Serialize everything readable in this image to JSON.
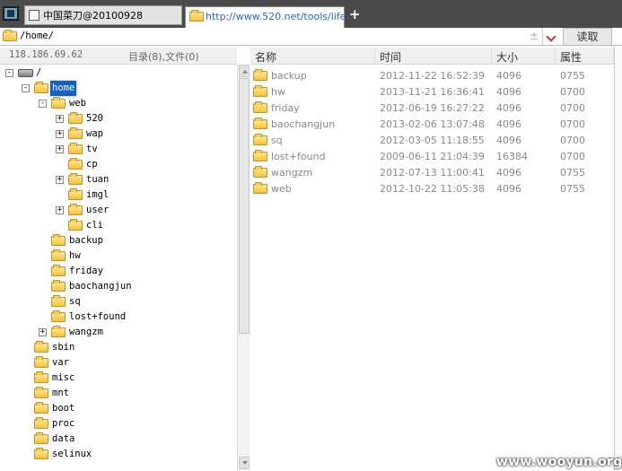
{
  "tabs": [
    {
      "label": "中国菜刀@20100928",
      "active": false
    },
    {
      "label": "http://www.520.net/tools/life...",
      "active": true
    }
  ],
  "new_tab_label": "+",
  "path_bar": {
    "value": "/home/",
    "plusminus": "±",
    "read_label": "读取"
  },
  "left_header": {
    "ip": "118.186.69.62",
    "dir_count": "目录(8),文件(0)"
  },
  "tree": [
    {
      "label": "/",
      "level": 0,
      "expander": "-",
      "icon": "drive"
    },
    {
      "label": "home",
      "level": 1,
      "expander": "-",
      "selected": true
    },
    {
      "label": "web",
      "level": 2,
      "expander": "-"
    },
    {
      "label": "520",
      "level": 3,
      "expander": "+"
    },
    {
      "label": "wap",
      "level": 3,
      "expander": "+"
    },
    {
      "label": "tv",
      "level": 3,
      "expander": "+"
    },
    {
      "label": "cp",
      "level": 3,
      "expander": ""
    },
    {
      "label": "tuan",
      "level": 3,
      "expander": "+"
    },
    {
      "label": "imgl",
      "level": 3,
      "expander": ""
    },
    {
      "label": "user",
      "level": 3,
      "expander": "+"
    },
    {
      "label": "cli",
      "level": 3,
      "expander": ""
    },
    {
      "label": "backup",
      "level": 2,
      "expander": ""
    },
    {
      "label": "hw",
      "level": 2,
      "expander": ""
    },
    {
      "label": "friday",
      "level": 2,
      "expander": ""
    },
    {
      "label": "baochangjun",
      "level": 2,
      "expander": ""
    },
    {
      "label": "sq",
      "level": 2,
      "expander": ""
    },
    {
      "label": "lost+found",
      "level": 2,
      "expander": ""
    },
    {
      "label": "wangzm",
      "level": 2,
      "expander": "+"
    },
    {
      "label": "sbin",
      "level": 1,
      "expander": ""
    },
    {
      "label": "var",
      "level": 1,
      "expander": ""
    },
    {
      "label": "misc",
      "level": 1,
      "expander": ""
    },
    {
      "label": "mnt",
      "level": 1,
      "expander": ""
    },
    {
      "label": "boot",
      "level": 1,
      "expander": ""
    },
    {
      "label": "proc",
      "level": 1,
      "expander": ""
    },
    {
      "label": "data",
      "level": 1,
      "expander": ""
    },
    {
      "label": "selinux",
      "level": 1,
      "expander": ""
    }
  ],
  "columns": {
    "name": "名称",
    "time": "时间",
    "size": "大小",
    "perm": "属性"
  },
  "files": [
    {
      "name": "backup",
      "time": "2012-11-22 16:52:39",
      "size": "4096",
      "perm": "0755"
    },
    {
      "name": "hw",
      "time": "2013-11-21 16:36:41",
      "size": "4096",
      "perm": "0700"
    },
    {
      "name": "friday",
      "time": "2012-06-19 16:27:22",
      "size": "4096",
      "perm": "0700"
    },
    {
      "name": "baochangjun",
      "time": "2013-02-06 13:07:48",
      "size": "4096",
      "perm": "0700"
    },
    {
      "name": "sq",
      "time": "2012-03-05 11:18:55",
      "size": "4096",
      "perm": "0700"
    },
    {
      "name": "lost+found",
      "time": "2009-06-11 21:04:39",
      "size": "16384",
      "perm": "0700"
    },
    {
      "name": "wangzm",
      "time": "2012-07-13 11:00:41",
      "size": "4096",
      "perm": "0755"
    },
    {
      "name": "web",
      "time": "2012-10-22 11:05:38",
      "size": "4096",
      "perm": "0755"
    }
  ],
  "watermark": "www.wooyun.org",
  "colors": {
    "selection": "#1560c0",
    "tab_link": "#2a6bd0",
    "tab_bar": "#4b4b4b"
  }
}
